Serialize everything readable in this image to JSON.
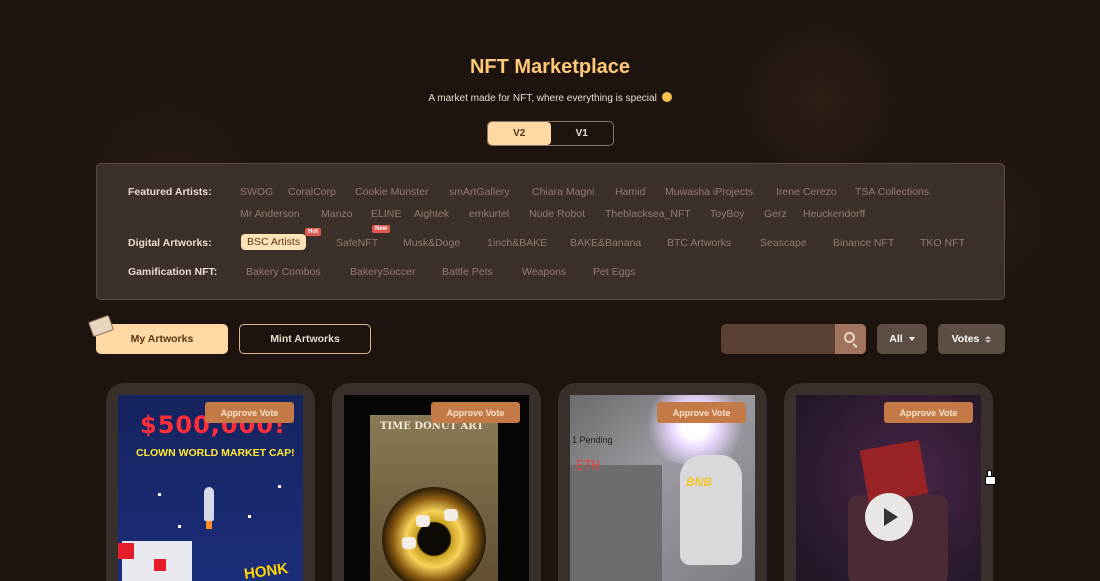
{
  "header": {
    "title": "NFT Marketplace",
    "subtitle": "A market made for NFT, where everything is special"
  },
  "version_toggle": {
    "options": [
      "V2",
      "V1"
    ],
    "selected": "V2"
  },
  "filters": {
    "featured": {
      "label": "Featured Artists:",
      "items": [
        "SWOG",
        "CoralCorp",
        "Cookie Munster",
        "smArtGallery",
        "Chiara Magni",
        "Hamid",
        "Muwasha iProjects",
        "Irene Cerezo",
        "TSA Collections",
        "Mr Anderson",
        "Manzo",
        "ELINE",
        "Aightek",
        "emkurtel",
        "Nude Robot",
        "Theblacksea_NFT",
        "ToyBoy",
        "Gerz",
        "Heuckendorff"
      ]
    },
    "digital": {
      "label": "Digital Artworks:",
      "items": [
        "BSC Artists",
        "SafeNFT",
        "Musk&Doge",
        "1inch&BAKE",
        "BAKE&Banana",
        "BTC Artworks",
        "Seascape",
        "Binance NFT",
        "TKO NFT"
      ],
      "selected": "BSC Artists",
      "badges": {
        "hot": "Hot",
        "new": "New"
      }
    },
    "gamification": {
      "label": "Gamification NFT:",
      "items": [
        "Bakery Combos",
        "BakerySoccer",
        "Battle Pets",
        "Weapons",
        "Pet Eggs"
      ]
    }
  },
  "actions": {
    "my_artworks": "My Artworks",
    "mint_artworks": "Mint Artworks",
    "search_placeholder": "",
    "filter_all": "All",
    "sort_votes": "Votes"
  },
  "cards": [
    {
      "approve_label": "Approve Vote",
      "art_text": "$500,000!",
      "art_text2": "CLOWN WORLD MARKET CAP!",
      "art_text3": "HONK"
    },
    {
      "approve_label": "Approve Vote",
      "art_text": "TIME DONUT ART"
    },
    {
      "approve_label": "Approve Vote",
      "art_text": "1 Pending",
      "art_text2": "ETH",
      "art_text3": "BNB"
    },
    {
      "approve_label": "Approve Vote"
    }
  ],
  "colors": {
    "background": "#1e140f",
    "accent": "#ffd8a3",
    "title": "#ffc978",
    "approve": "#c47a46"
  }
}
